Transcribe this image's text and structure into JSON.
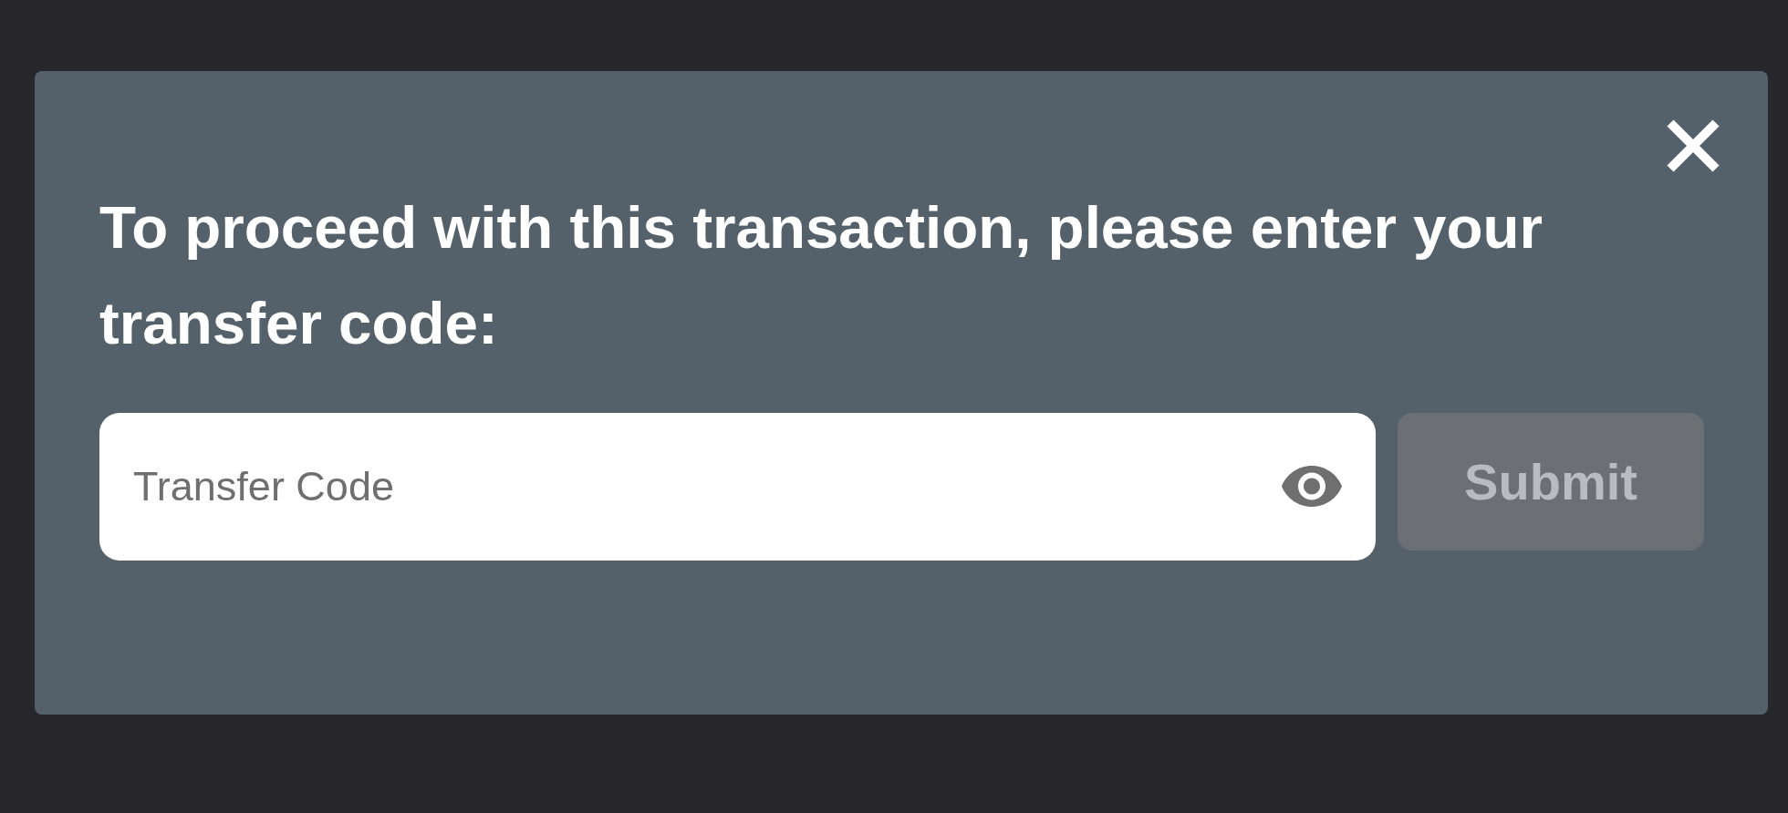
{
  "dialog": {
    "heading": "To proceed with this transaction, please enter your transfer code:",
    "transfer_code_field": {
      "placeholder": "Transfer Code"
    },
    "submit_button": {
      "label": "Submit",
      "disabled": true
    }
  }
}
